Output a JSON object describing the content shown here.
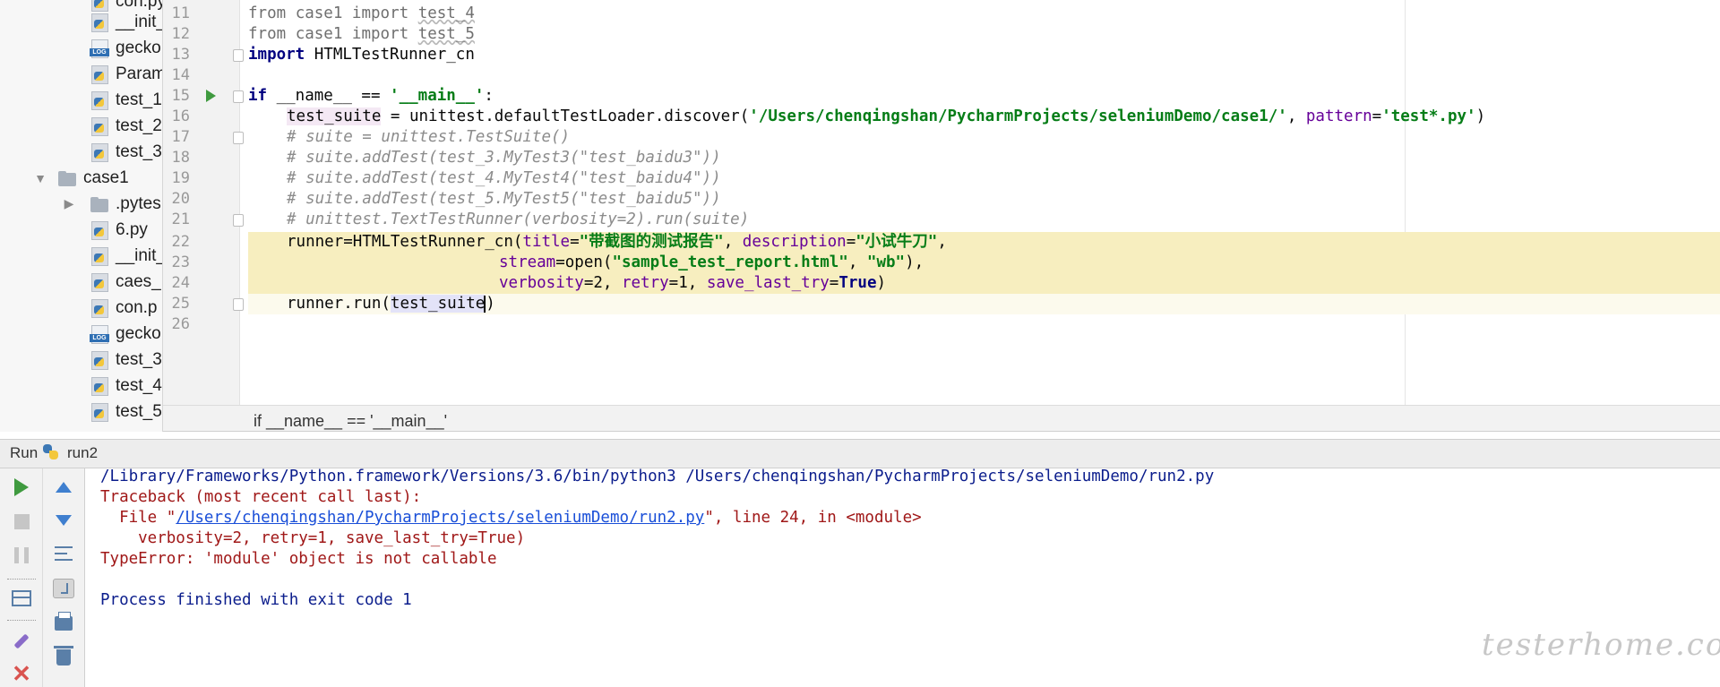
{
  "project_tree": {
    "items": [
      {
        "label": "con.py",
        "icon": "python-file-icon"
      },
      {
        "label": "__init__",
        "icon": "python-file-icon"
      },
      {
        "label": "gecko",
        "icon": "log-file-icon"
      },
      {
        "label": "Param",
        "icon": "python-file-icon"
      },
      {
        "label": "test_1",
        "icon": "python-file-icon"
      },
      {
        "label": "test_2",
        "icon": "python-file-icon"
      },
      {
        "label": "test_3",
        "icon": "python-file-icon"
      },
      {
        "label": "case1",
        "icon": "folder-icon",
        "expanded": true
      },
      {
        "label": ".pytes",
        "icon": "folder-icon",
        "expanded": false
      },
      {
        "label": "6.py",
        "icon": "python-file-icon"
      },
      {
        "label": "__init_",
        "icon": "python-file-icon"
      },
      {
        "label": "caes_",
        "icon": "python-file-icon"
      },
      {
        "label": "con.p",
        "icon": "python-file-icon"
      },
      {
        "label": "gecko",
        "icon": "log-file-icon"
      },
      {
        "label": "test_3",
        "icon": "python-file-icon"
      },
      {
        "label": "test_4",
        "icon": "python-file-icon"
      },
      {
        "label": "test_5",
        "icon": "python-file-icon"
      }
    ]
  },
  "editor": {
    "line_numbers": [
      "11",
      "12",
      "13",
      "14",
      "15",
      "16",
      "17",
      "18",
      "19",
      "20",
      "21",
      "22",
      "23",
      "24",
      "25",
      "26"
    ],
    "lines": {
      "l11_a": "from",
      "l11_b": " case1 ",
      "l11_c": "import",
      "l11_d": "test_4",
      "l12_a": "from",
      "l12_b": " case1 ",
      "l12_c": "import",
      "l12_d": "test_5",
      "l13_a": "import",
      "l13_b": " HTMLTestRunner_cn",
      "l15_a": "if",
      "l15_b": " __name__ == ",
      "l15_c": "'__main__'",
      "l15_d": ":",
      "l16_a": "test_suite",
      "l16_b": " = unittest.defaultTestLoader.discover(",
      "l16_c": "'/Users/chenqingshan/PycharmProjects/seleniumDemo/case1/'",
      "l16_d": ", ",
      "l16_e": "pattern",
      "l16_f": "=",
      "l16_g": "'test*.py'",
      "l16_h": ")",
      "l17": "# suite = unittest.TestSuite()",
      "l18": "# suite.addTest(test_3.MyTest3(\"test_baidu3\"))",
      "l19": "# suite.addTest(test_4.MyTest4(\"test_baidu4\"))",
      "l20": "# suite.addTest(test_5.MyTest5(\"test_baidu5\"))",
      "l21": "# unittest.TextTestRunner(verbosity=2).run(suite)",
      "l22_a": "runner=HTMLTestRunner_cn(",
      "l22_b": "title",
      "l22_c": "=",
      "l22_d": "\"带截图的测试报告\"",
      "l22_e": ", ",
      "l22_f": "description",
      "l22_g": "=",
      "l22_h": "\"小试牛刀\"",
      "l22_i": ",",
      "l23_a": "stream",
      "l23_b": "=open(",
      "l23_c": "\"sample_test_report.html\"",
      "l23_d": ", ",
      "l23_e": "\"wb\"",
      "l23_f": "),",
      "l24_a": "verbosity",
      "l24_b": "=2, ",
      "l24_c": "retry",
      "l24_d": "=1, ",
      "l24_e": "save_last_try",
      "l24_f": "=",
      "l24_g": "True",
      "l24_h": ")",
      "l25_a": "runner.run(",
      "l25_b": "test_suite",
      "l25_c": ")"
    }
  },
  "breadcrumb": "if __name__ == '__main__'",
  "run_panel": {
    "title": "Run",
    "config_name": "run2",
    "console": {
      "cmd": "/Library/Frameworks/Python.framework/Versions/3.6/bin/python3 /Users/chenqingshan/PycharmProjects/seleniumDemo/run2.py",
      "traceback_header": "Traceback (most recent call last):",
      "file_prefix": "  File \"",
      "file_link": "/Users/chenqingshan/PycharmProjects/seleniumDemo/run2.py",
      "file_suffix": "\", line 24, in <module>",
      "code_line": "    verbosity=2, retry=1, save_last_try=True)",
      "error": "TypeError: 'module' object is not callable",
      "exit_msg": "Process finished with exit code 1"
    }
  },
  "watermark": "testerhome.com",
  "colors": {
    "keyword": "#000080",
    "string": "#067d17",
    "comment": "#8c8c8c",
    "kwarg": "#660099",
    "error_red": "#a01818",
    "link_blue": "#1a4fd8",
    "highlight": "#f7eebf"
  }
}
